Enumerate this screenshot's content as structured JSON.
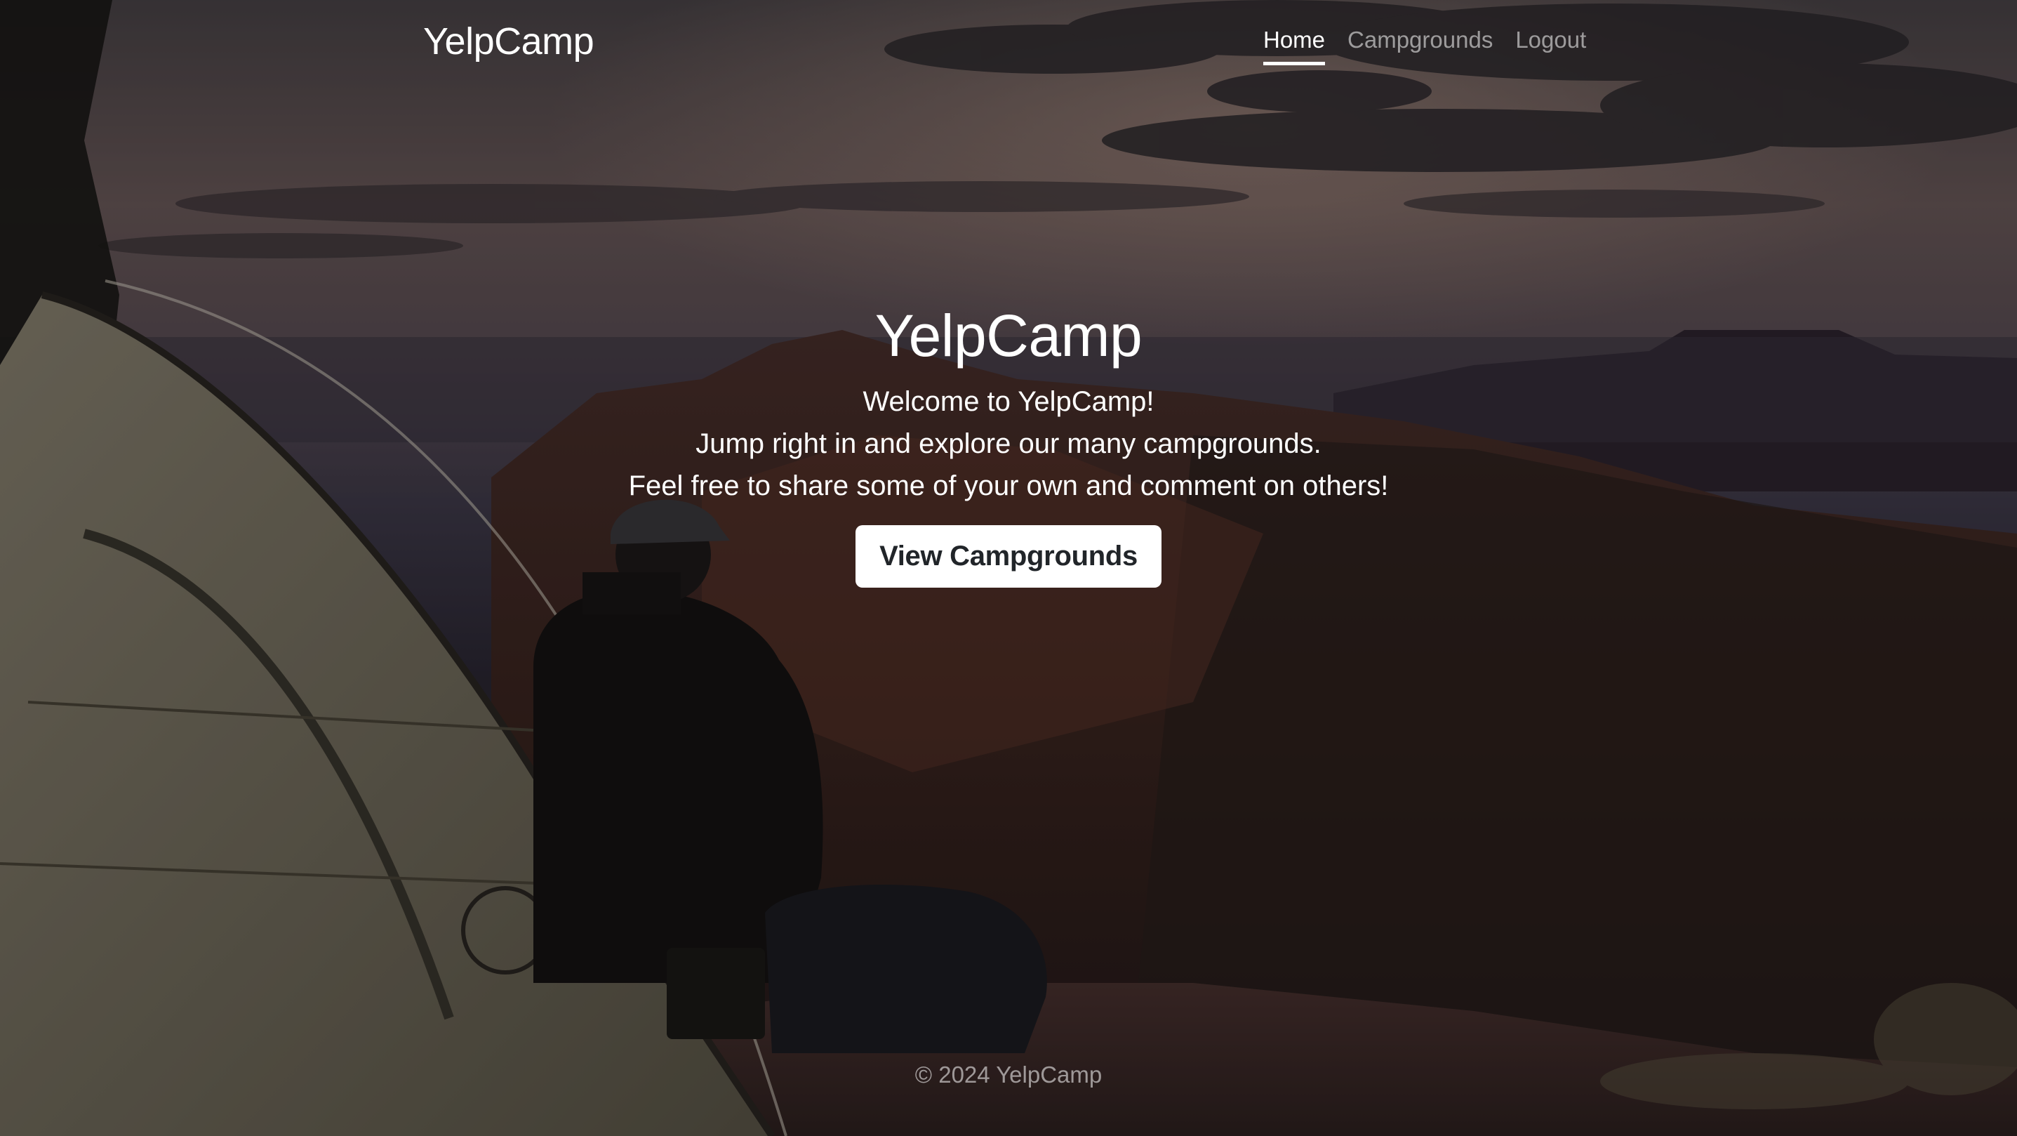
{
  "navbar": {
    "brand": "YelpCamp",
    "links": [
      {
        "label": "Home",
        "active": true
      },
      {
        "label": "Campgrounds",
        "active": false
      },
      {
        "label": "Logout",
        "active": false
      }
    ]
  },
  "hero": {
    "title": "YelpCamp",
    "lines": [
      "Welcome to YelpCamp!",
      "Jump right in and explore our many campgrounds.",
      "Feel free to share some of your own and comment on others!"
    ],
    "cta_label": "View Campgrounds"
  },
  "footer": {
    "text": "© 2024 YelpCamp"
  },
  "colors": {
    "text": "#ffffff",
    "muted_text": "rgba(255,255,255,0.55)",
    "button_bg": "#ffffff",
    "button_text": "#212529"
  }
}
